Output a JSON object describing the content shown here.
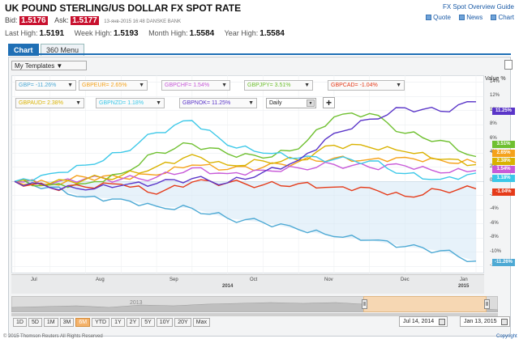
{
  "header": {
    "title": "UK POUND STERLING/US DOLLAR FX SPOT RATE",
    "guide_link": "FX Spot Overview Guide",
    "links": [
      "Quote",
      "News",
      "Chart"
    ]
  },
  "quote": {
    "bid_label": "Bid:",
    "bid": "1.5176",
    "ask_label": "Ask:",
    "ask": "1.5177",
    "timestamp": "13-янв-2015 16:48 DANSKE BANK"
  },
  "highs": {
    "last_high_label": "Last High:",
    "last_high": "1.5191",
    "week_high_label": "Week High:",
    "week_high": "1.5193",
    "month_high_label": "Month High:",
    "month_high": "1.5584",
    "year_high_label": "Year High:",
    "year_high": "1.5584"
  },
  "tabs": [
    "Chart",
    "360 Menu"
  ],
  "toolbar": {
    "templates": "My Templates ▼",
    "interval": "Daily",
    "add_label": "+",
    "unit_label": "Value %"
  },
  "series_pills": [
    {
      "label": "GBP= -11.26%",
      "color": "#4da9d4"
    },
    {
      "label": "GBPEUR= 2.65%",
      "color": "#f5a21b"
    },
    {
      "label": "GBPCHF= 1.54%",
      "color": "#c85ad8"
    },
    {
      "label": "GBPJPY= 3.51%",
      "color": "#6fc030"
    },
    {
      "label": "GBPCAD= -1.04%",
      "color": "#e53b1a"
    },
    {
      "label": "GBPAUD= 2.38%",
      "color": "#d9b200"
    },
    {
      "label": "GBPNZD= 1.18%",
      "color": "#3cc8e8"
    },
    {
      "label": "GBPNOK= 11.25%",
      "color": "#5a35c8"
    }
  ],
  "last_value_tags": [
    {
      "text": "11.25%",
      "value": 11.25,
      "color": "#5a35c8"
    },
    {
      "text": "3.51%",
      "value": 3.51,
      "color": "#6fc030"
    },
    {
      "text": "2.65%",
      "value": 2.65,
      "color": "#f5a21b"
    },
    {
      "text": "2.38%",
      "value": 2.38,
      "color": "#d9b200"
    },
    {
      "text": "1.54%",
      "value": 1.54,
      "color": "#c85ad8"
    },
    {
      "text": "1.18%",
      "value": 1.18,
      "color": "#3cc8e8"
    },
    {
      "text": "-1.04%",
      "value": -1.04,
      "color": "#e53b1a"
    },
    {
      "text": "-11.26%",
      "value": -11.26,
      "color": "#4da9d4"
    }
  ],
  "y_ticks": [
    "14%",
    "12%",
    "10%",
    "8%",
    "6%",
    "4%",
    "2%",
    "0%",
    "-2%",
    "-4%",
    "-6%",
    "-8%",
    "-10%",
    "-12%"
  ],
  "x_labels": [
    "Jul",
    "Aug",
    "Sep",
    "Oct",
    "Nov",
    "Dec",
    "Jan"
  ],
  "x_years": [
    "2014",
    "2015"
  ],
  "navigator": {
    "year": "2013"
  },
  "range_buttons": [
    "1D",
    "5D",
    "1M",
    "3M",
    "6M",
    "YTD",
    "1Y",
    "2Y",
    "5Y",
    "10Y",
    "20Y",
    "Max"
  ],
  "active_range": "6M",
  "dates": {
    "from": "Jul 14, 2014",
    "to": "Jan 13, 2015"
  },
  "footer": {
    "copyright": "© 2015 Thomson Reuters All Rights Reserved",
    "right_link": "Copyright"
  },
  "chart_data": {
    "type": "line",
    "x": [
      "Jul 14",
      "Jul 28",
      "Aug 11",
      "Aug 25",
      "Sep 08",
      "Sep 22",
      "Oct 06",
      "Oct 20",
      "Nov 03",
      "Nov 17",
      "Dec 01",
      "Dec 15",
      "Dec 29",
      "Jan 13"
    ],
    "ylim": [
      -13,
      15
    ],
    "ylabel": "Value %",
    "series": [
      {
        "name": "GBP=",
        "color": "#4da9d4",
        "values": [
          0,
          -0.8,
          -2.2,
          -2.5,
          -3.5,
          -3.8,
          -5.2,
          -5.8,
          -6.8,
          -7.8,
          -8.3,
          -9.2,
          -9.8,
          -11.26
        ]
      },
      {
        "name": "GBPEUR=",
        "color": "#f5a21b",
        "values": [
          0,
          -0.3,
          0.6,
          0.5,
          0.9,
          2.3,
          1.7,
          2.0,
          2.8,
          3.3,
          3.1,
          3.4,
          3.0,
          2.65
        ]
      },
      {
        "name": "GBPCHF=",
        "color": "#c85ad8",
        "values": [
          0,
          -0.4,
          0.4,
          0.3,
          0.6,
          1.9,
          1.1,
          1.6,
          1.9,
          2.4,
          2.0,
          2.2,
          1.2,
          1.54
        ]
      },
      {
        "name": "GBPJPY=",
        "color": "#6fc030",
        "values": [
          0,
          -0.5,
          -0.3,
          1.1,
          4.1,
          5.3,
          3.9,
          3.3,
          4.6,
          9.1,
          9.6,
          6.8,
          5.8,
          3.51
        ]
      },
      {
        "name": "GBPCAD=",
        "color": "#e53b1a",
        "values": [
          0,
          -0.9,
          -0.8,
          -0.4,
          -1.8,
          -0.1,
          -0.2,
          -0.5,
          -0.3,
          -0.8,
          -0.9,
          -2.1,
          -1.2,
          -1.04
        ]
      },
      {
        "name": "GBPAUD=",
        "color": "#d9b200",
        "values": [
          0,
          -0.3,
          0.3,
          0.8,
          2.1,
          3.8,
          2.3,
          2.9,
          3.0,
          5.1,
          4.8,
          4.2,
          3.1,
          2.38
        ]
      },
      {
        "name": "GBPNZD=",
        "color": "#3cc8e8",
        "values": [
          0,
          1.1,
          2.3,
          4.1,
          6.9,
          8.6,
          5.1,
          4.0,
          3.3,
          3.1,
          2.9,
          1.1,
          0.3,
          1.18
        ]
      },
      {
        "name": "GBPNOK=",
        "color": "#5a35c8",
        "values": [
          0,
          -0.9,
          -1.2,
          -0.6,
          -0.3,
          0.4,
          -0.2,
          1.3,
          3.0,
          6.8,
          8.8,
          10.4,
          9.9,
          11.25
        ]
      }
    ]
  }
}
